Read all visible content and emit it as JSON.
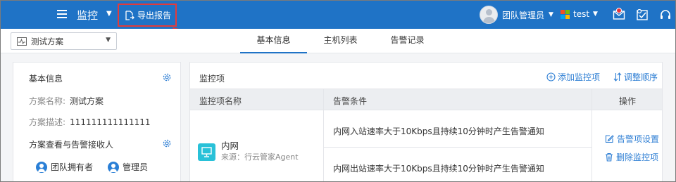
{
  "header": {
    "app_title": "监控",
    "export_label": "导出报告",
    "user_name": "团队管理员",
    "org_name": "test"
  },
  "toolbar": {
    "plan_select_value": "测试方案",
    "tabs": [
      {
        "label": "基本信息",
        "active": true
      },
      {
        "label": "主机列表",
        "active": false
      },
      {
        "label": "告警记录",
        "active": false
      }
    ]
  },
  "basic_info": {
    "title": "基本信息",
    "name_label": "方案名称:",
    "name_value": "测试方案",
    "desc_label": "方案描述:",
    "desc_value": "111111111111111",
    "receivers_title": "方案查看与告警接收人",
    "receivers": [
      "团队拥有者",
      "管理员"
    ]
  },
  "monitor": {
    "title": "监控项",
    "add_label": "添加监控项",
    "order_label": "调整顺序",
    "columns": [
      "监控项名称",
      "告警条件",
      "操作"
    ],
    "row": {
      "name": "内网",
      "source": "来源：行云管家Agent",
      "conditions": [
        "内网入站速率大于10Kbps且持续10分钟时产生告警通知",
        "内网出站速率大于10Kbps且持续10分钟时产生告警通知"
      ],
      "actions": [
        "告警项设置",
        "删除监控项"
      ]
    }
  },
  "colors": {
    "header_bg": "#1f73c6",
    "link": "#2f7fd4",
    "highlight": "#e23b3b"
  }
}
